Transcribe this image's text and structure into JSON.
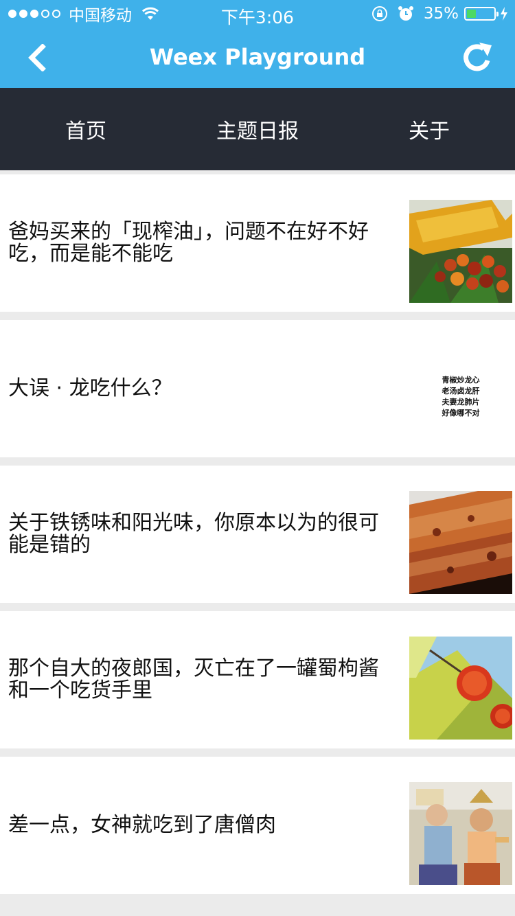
{
  "status_bar": {
    "carrier": "中国移动",
    "time": "下午3:06",
    "battery_percent": "35%",
    "battery_level": 0.35,
    "signal_dots_filled": 3,
    "signal_dots_total": 5
  },
  "nav": {
    "title": "Weex Playground",
    "back_icon": "chevron-left-icon",
    "refresh_icon": "refresh-icon"
  },
  "tabs": [
    {
      "label": "首页"
    },
    {
      "label": "主题日报"
    },
    {
      "label": "关于"
    }
  ],
  "articles": [
    {
      "title": "爸妈买来的「现榨油」，问题不在好不好吃，而是能不能吃",
      "image": "oil-bottle-palm-fruit-photo"
    },
    {
      "title": "大误 · 龙吃什么？",
      "image": "text-image",
      "image_lines": [
        "青椒炒龙心",
        "老汤卤龙肝",
        "夫妻龙肺片",
        "好像哪不对"
      ]
    },
    {
      "title": "关于铁锈味和阳光味，你原本以为的很可能是错的",
      "image": "rusty-pipe-photo"
    },
    {
      "title": "那个自大的夜郎国，灭亡在了一罐蜀枸酱和一个吃货手里",
      "image": "red-berries-leaf-photo"
    },
    {
      "title": "差一点，女神就吃到了唐僧肉",
      "image": "costumed-couple-photo"
    }
  ],
  "colors": {
    "header_blue": "#3fb1ea",
    "tab_bar": "#262b35",
    "separator": "#ebebeb"
  }
}
